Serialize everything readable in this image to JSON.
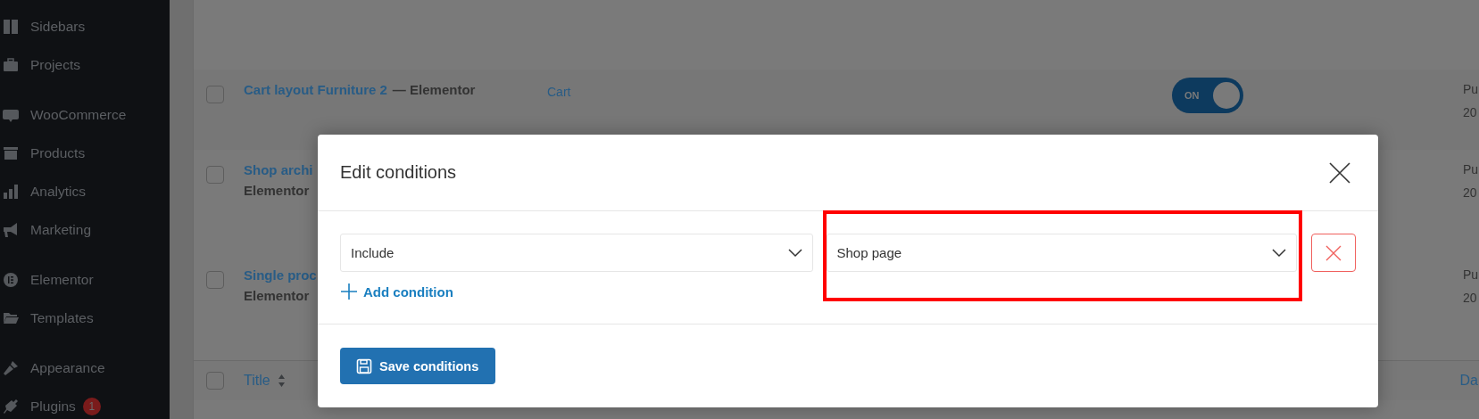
{
  "sidebar": {
    "items": [
      {
        "label": "Sidebars"
      },
      {
        "label": "Projects"
      },
      {
        "label": "WooCommerce"
      },
      {
        "label": "Products"
      },
      {
        "label": "Analytics"
      },
      {
        "label": "Marketing"
      },
      {
        "label": "Elementor"
      },
      {
        "label": "Templates"
      },
      {
        "label": "Appearance"
      },
      {
        "label": "Plugins",
        "badge": "1"
      }
    ]
  },
  "table": {
    "rows": [
      {
        "checked": false,
        "title": "Cart layout Furniture 2",
        "suffix": "— Elementor",
        "type": "Cart",
        "toggle": {
          "label": "ON",
          "on": true
        },
        "column_5": [
          "Pu",
          "20"
        ]
      },
      {
        "checked": false,
        "title": "Shop archi",
        "subtitle": "Elementor",
        "column_5": [
          "Pu",
          "20"
        ]
      },
      {
        "checked": false,
        "title": "Single proc",
        "subtitle": "Elementor",
        "column_5": [
          "Pu",
          "20"
        ]
      }
    ],
    "footer": {
      "checked": false,
      "title": "Title",
      "column_5": "Da"
    }
  },
  "dialog": {
    "title": "Edit conditions",
    "conditions": [
      {
        "selects": [
          {
            "value": "Include",
            "highlighted": false
          },
          {
            "value": "Shop page",
            "highlighted": true
          }
        ]
      }
    ],
    "add_condition": "Add condition",
    "save": "Save conditions"
  }
}
